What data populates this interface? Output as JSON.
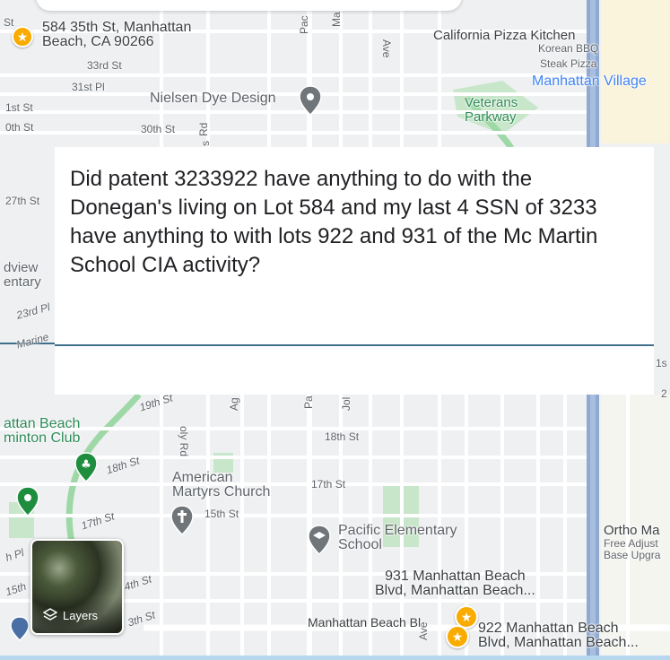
{
  "question": "Did patent 3233922 have anything to do with the Donegan's living on Lot 584 and my last 4 SSN of 3233 have anything to with  lots 922 and 931 of the Mc Martin School CIA activity?",
  "map": {
    "streets": [
      {
        "id": "33rd",
        "label": "33rd St"
      },
      {
        "id": "31st-pl",
        "label": "31st Pl"
      },
      {
        "id": "31st",
        "label": "1st St"
      },
      {
        "id": "30th-left",
        "label": "0th St"
      },
      {
        "id": "30th",
        "label": "30th St"
      },
      {
        "id": "27th",
        "label": "27th St"
      },
      {
        "id": "23rd-pl",
        "label": "23rd Pl"
      },
      {
        "id": "marine",
        "label": "Marine"
      },
      {
        "id": "19th",
        "label": "19th St"
      },
      {
        "id": "18th-left",
        "label": "18th St"
      },
      {
        "id": "18th",
        "label": "18th St"
      },
      {
        "id": "17th-left",
        "label": "17th St"
      },
      {
        "id": "17th",
        "label": "17th St"
      },
      {
        "id": "15th",
        "label": "15th St"
      },
      {
        "id": "14th",
        "label": "4th St"
      },
      {
        "id": "13th",
        "label": "3th St"
      },
      {
        "id": "15th-left",
        "label": "15th"
      },
      {
        "id": "pl-left",
        "label": "h Pl"
      },
      {
        "id": "mb-blvd",
        "label": "Manhattan Beach Bl"
      },
      {
        "id": "pac-top",
        "label": "Pac"
      },
      {
        "id": "ma-top",
        "label": "Ma"
      },
      {
        "id": "ave-top",
        "label": "Ave"
      },
      {
        "id": "rd-30th",
        "label": "Rd"
      },
      {
        "id": "s-30th",
        "label": "s"
      },
      {
        "id": "holy-rd",
        "label": "oly Rd"
      },
      {
        "id": "ag",
        "label": "Ag"
      },
      {
        "id": "pa-mid",
        "label": "Pa"
      },
      {
        "id": "jol",
        "label": "Jol"
      },
      {
        "id": "ave-bottom",
        "label": "Ave"
      },
      {
        "id": "st-top",
        "label": "St"
      },
      {
        "id": "right-1s",
        "label": "1s"
      },
      {
        "id": "right-2",
        "label": "2"
      }
    ],
    "places": {
      "address_584": {
        "line1": "584 35th St, Manhattan",
        "line2": "Beach, CA 90266"
      },
      "california_pizza": "California Pizza Kitchen",
      "korean_bbq": "Korean BBQ",
      "steak_pizza": "Steak Pizza",
      "manhattan_village": "Manhattan Village",
      "nielsen": "Nielsen Dye Design",
      "veterans": {
        "line1": "Veterans",
        "line2": "Parkway"
      },
      "dview": {
        "line1": "dview",
        "line2": "entary"
      },
      "badminton": {
        "line1": "attan Beach",
        "line2": "minton Club"
      },
      "american_martyrs": {
        "line1": "American",
        "line2": "Martyrs Church"
      },
      "pacific_elementary": {
        "line1": "Pacific Elementary",
        "line2": "School"
      },
      "ortho": {
        "line1": "Ortho Ma",
        "line2": "Free Adjust",
        "line3": "Base Upgra"
      },
      "address_931": {
        "line1": "931 Manhattan Beach",
        "line2": "Blvd, Manhattan Beach..."
      },
      "address_922": {
        "line1": "922 Manhattan Beach",
        "line2": "Blvd, Manhattan Beach..."
      }
    },
    "layers_label": "Layers",
    "colors": {
      "background": "#eef0f2",
      "road": "#ffffff",
      "highway": "#7f9fc6",
      "park": "#c8e6c9",
      "parkway": "#9ed8a6",
      "commercial": "#fbf4dc",
      "star_pin": "#f9ab00",
      "gray_pin": "#70757a",
      "green_pin": "#1e8e3e"
    }
  }
}
